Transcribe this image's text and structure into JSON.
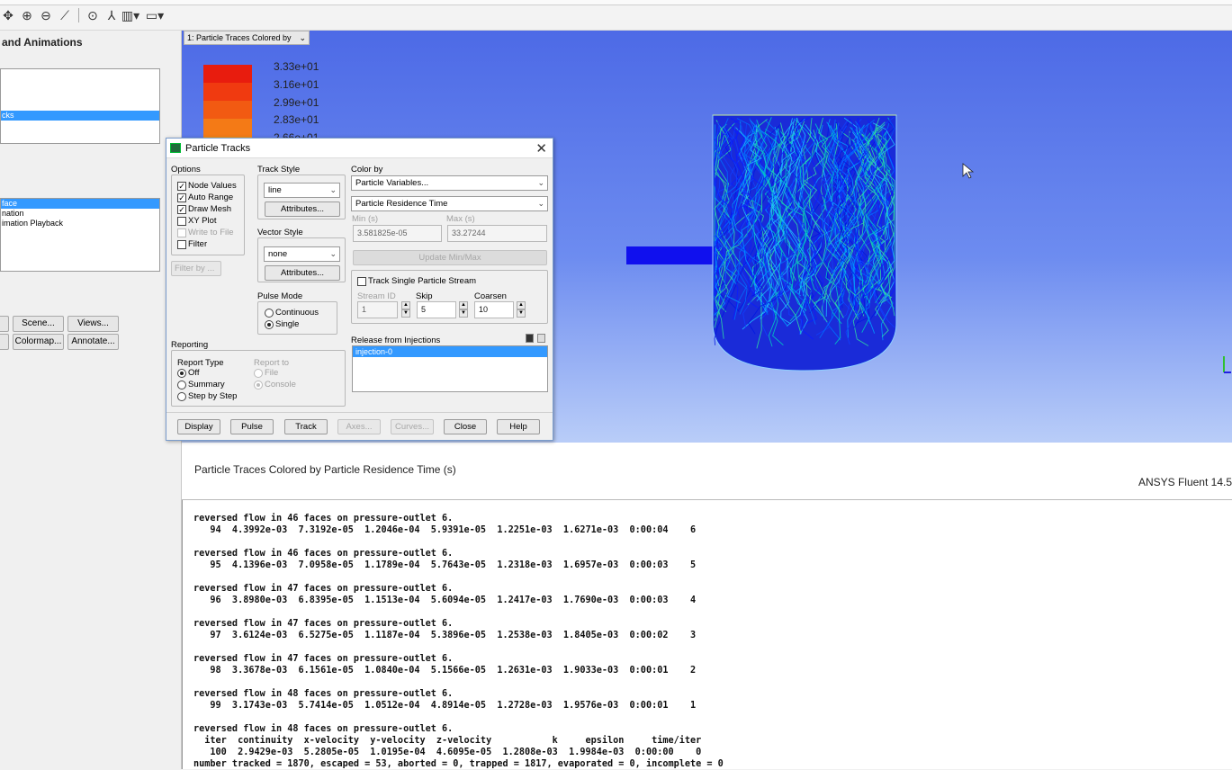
{
  "toolbar": {
    "icons": [
      "pan-icon",
      "zoom-in-icon",
      "zoom-out-icon",
      "probe-icon",
      "zoom-fit-icon",
      "axes-icon",
      "views-icon",
      "window-icon"
    ]
  },
  "left_panel": {
    "title": "and Animations",
    "list1": [
      "",
      "",
      "",
      "",
      "cks"
    ],
    "list1_selected": 4,
    "list2": [
      "face",
      "nation",
      "imation Playback"
    ],
    "list2_selected": 0,
    "buttons": {
      "scene": "Scene...",
      "views": "Views...",
      "colormap": "Colormap...",
      "annotate": "Annotate..."
    }
  },
  "graphics": {
    "tab_label": "1: Particle Traces Colored by",
    "legend": [
      "3.33e+01",
      "3.16e+01",
      "2.99e+01",
      "2.83e+01",
      "2.66e+01"
    ],
    "legend_colors": [
      "#e81c0e",
      "#f03a10",
      "#f25a12",
      "#f47a16",
      "#f59a1a"
    ],
    "caption": "Particle Traces Colored by Particle Residence Time (s)",
    "version": "ANSYS Fluent 14.5"
  },
  "dialog": {
    "title": "Particle Tracks",
    "options_label": "Options",
    "options": [
      {
        "label": "Node Values",
        "checked": true,
        "enabled": true
      },
      {
        "label": "Auto Range",
        "checked": true,
        "enabled": true
      },
      {
        "label": "Draw Mesh",
        "checked": true,
        "enabled": true
      },
      {
        "label": "XY Plot",
        "checked": false,
        "enabled": true
      },
      {
        "label": "Write to File",
        "checked": false,
        "enabled": false
      },
      {
        "label": "Filter",
        "checked": false,
        "enabled": true
      }
    ],
    "filter_by": "Filter by ...",
    "track_style_label": "Track Style",
    "track_style_value": "line",
    "attributes_label": "Attributes...",
    "vector_style_label": "Vector Style",
    "vector_style_value": "none",
    "pulse_mode_label": "Pulse Mode",
    "pulse_continuous": "Continuous",
    "pulse_single": "Single",
    "color_by_label": "Color by",
    "color_by_1": "Particle Variables...",
    "color_by_2": "Particle Residence Time",
    "min_label": "Min (s)",
    "max_label": "Max (s)",
    "min_value": "3.581825e-05",
    "max_value": "33.27244",
    "update_minmax": "Update Min/Max",
    "track_single": "Track Single Particle Stream",
    "stream_id_label": "Stream ID",
    "stream_id_value": "1",
    "skip_label": "Skip",
    "skip_value": "5",
    "coarsen_label": "Coarsen",
    "coarsen_value": "10",
    "release_label": "Release from Injections",
    "injection": "injection-0",
    "reporting_label": "Reporting",
    "report_type_label": "Report Type",
    "report_off": "Off",
    "report_summary": "Summary",
    "report_step": "Step by Step",
    "report_to_label": "Report to",
    "report_file": "File",
    "report_console": "Console",
    "buttons": {
      "display": "Display",
      "pulse": "Pulse",
      "track": "Track",
      "axes": "Axes...",
      "curves": "Curves...",
      "close": "Close",
      "help": "Help"
    }
  },
  "console": {
    "text": "reversed flow in 46 faces on pressure-outlet 6.\n   94  4.3992e-03  7.3192e-05  1.2046e-04  5.9391e-05  1.2251e-03  1.6271e-03  0:00:04    6\n\nreversed flow in 46 faces on pressure-outlet 6.\n   95  4.1396e-03  7.0958e-05  1.1789e-04  5.7643e-05  1.2318e-03  1.6957e-03  0:00:03    5\n\nreversed flow in 47 faces on pressure-outlet 6.\n   96  3.8980e-03  6.8395e-05  1.1513e-04  5.6094e-05  1.2417e-03  1.7690e-03  0:00:03    4\n\nreversed flow in 47 faces on pressure-outlet 6.\n   97  3.6124e-03  6.5275e-05  1.1187e-04  5.3896e-05  1.2538e-03  1.8405e-03  0:00:02    3\n\nreversed flow in 47 faces on pressure-outlet 6.\n   98  3.3678e-03  6.1561e-05  1.0840e-04  5.1566e-05  1.2631e-03  1.9033e-03  0:00:01    2\n\nreversed flow in 48 faces on pressure-outlet 6.\n   99  3.1743e-03  5.7414e-05  1.0512e-04  4.8914e-05  1.2728e-03  1.9576e-03  0:00:01    1\n\nreversed flow in 48 faces on pressure-outlet 6.\n  iter  continuity  x-velocity  y-velocity  z-velocity           k     epsilon     time/iter\n   100  2.9429e-03  5.2805e-05  1.0195e-04  4.6095e-05  1.2808e-03  1.9984e-03  0:00:00    0\nnumber tracked = 1870, escaped = 53, aborted = 0, trapped = 1817, evaporated = 0, incomplete = 0"
  }
}
